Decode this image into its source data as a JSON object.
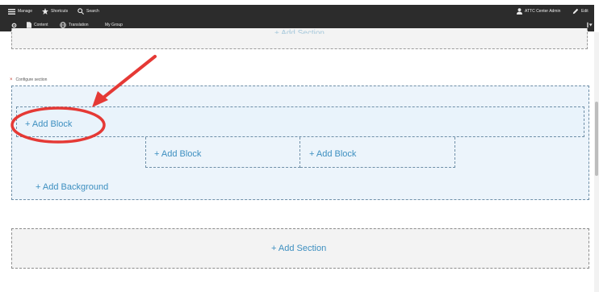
{
  "toolbar": {
    "manage": "Manage",
    "shortcuts": "Shortcuts",
    "search": "Search",
    "user": "ATTC Center Admin",
    "edit": "Edit",
    "content": "Content",
    "translation": "Translation",
    "my_group": "My Group"
  },
  "previous_section": {
    "label": "+ Add Section"
  },
  "configure_section": {
    "close": "×",
    "label": "Configure section"
  },
  "section": {
    "add_block_1": "+ Add Block",
    "add_block_2": "+ Add Block",
    "add_block_3": "+ Add Block",
    "add_background": "+ Add Background"
  },
  "bottom": {
    "add_section": "+ Add Section"
  },
  "colors": {
    "toolbar_bg": "#2c2c2c",
    "link": "#3d8fc0",
    "section_bg": "#ecf4fb",
    "annotation_red": "#e53935"
  }
}
